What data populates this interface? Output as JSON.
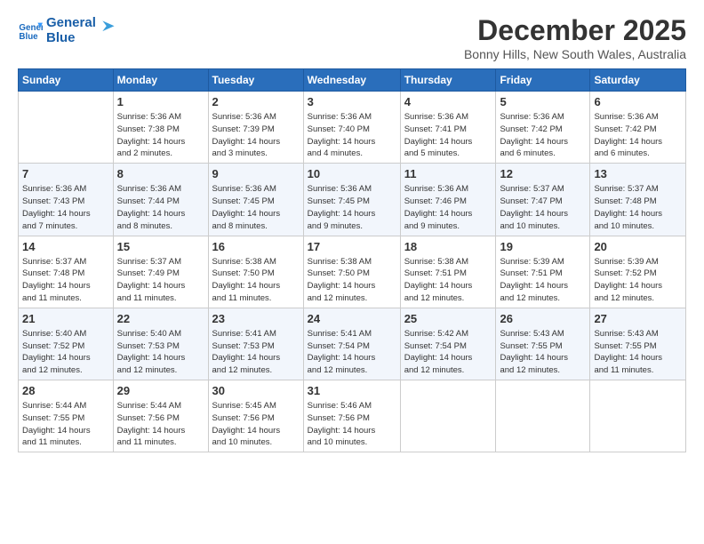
{
  "logo": {
    "line1": "General",
    "line2": "Blue"
  },
  "title": "December 2025",
  "location": "Bonny Hills, New South Wales, Australia",
  "days_of_week": [
    "Sunday",
    "Monday",
    "Tuesday",
    "Wednesday",
    "Thursday",
    "Friday",
    "Saturday"
  ],
  "weeks": [
    [
      {
        "day": "",
        "info": ""
      },
      {
        "day": "1",
        "info": "Sunrise: 5:36 AM\nSunset: 7:38 PM\nDaylight: 14 hours\nand 2 minutes."
      },
      {
        "day": "2",
        "info": "Sunrise: 5:36 AM\nSunset: 7:39 PM\nDaylight: 14 hours\nand 3 minutes."
      },
      {
        "day": "3",
        "info": "Sunrise: 5:36 AM\nSunset: 7:40 PM\nDaylight: 14 hours\nand 4 minutes."
      },
      {
        "day": "4",
        "info": "Sunrise: 5:36 AM\nSunset: 7:41 PM\nDaylight: 14 hours\nand 5 minutes."
      },
      {
        "day": "5",
        "info": "Sunrise: 5:36 AM\nSunset: 7:42 PM\nDaylight: 14 hours\nand 6 minutes."
      },
      {
        "day": "6",
        "info": "Sunrise: 5:36 AM\nSunset: 7:42 PM\nDaylight: 14 hours\nand 6 minutes."
      }
    ],
    [
      {
        "day": "7",
        "info": "Sunrise: 5:36 AM\nSunset: 7:43 PM\nDaylight: 14 hours\nand 7 minutes."
      },
      {
        "day": "8",
        "info": "Sunrise: 5:36 AM\nSunset: 7:44 PM\nDaylight: 14 hours\nand 8 minutes."
      },
      {
        "day": "9",
        "info": "Sunrise: 5:36 AM\nSunset: 7:45 PM\nDaylight: 14 hours\nand 8 minutes."
      },
      {
        "day": "10",
        "info": "Sunrise: 5:36 AM\nSunset: 7:45 PM\nDaylight: 14 hours\nand 9 minutes."
      },
      {
        "day": "11",
        "info": "Sunrise: 5:36 AM\nSunset: 7:46 PM\nDaylight: 14 hours\nand 9 minutes."
      },
      {
        "day": "12",
        "info": "Sunrise: 5:37 AM\nSunset: 7:47 PM\nDaylight: 14 hours\nand 10 minutes."
      },
      {
        "day": "13",
        "info": "Sunrise: 5:37 AM\nSunset: 7:48 PM\nDaylight: 14 hours\nand 10 minutes."
      }
    ],
    [
      {
        "day": "14",
        "info": "Sunrise: 5:37 AM\nSunset: 7:48 PM\nDaylight: 14 hours\nand 11 minutes."
      },
      {
        "day": "15",
        "info": "Sunrise: 5:37 AM\nSunset: 7:49 PM\nDaylight: 14 hours\nand 11 minutes."
      },
      {
        "day": "16",
        "info": "Sunrise: 5:38 AM\nSunset: 7:50 PM\nDaylight: 14 hours\nand 11 minutes."
      },
      {
        "day": "17",
        "info": "Sunrise: 5:38 AM\nSunset: 7:50 PM\nDaylight: 14 hours\nand 12 minutes."
      },
      {
        "day": "18",
        "info": "Sunrise: 5:38 AM\nSunset: 7:51 PM\nDaylight: 14 hours\nand 12 minutes."
      },
      {
        "day": "19",
        "info": "Sunrise: 5:39 AM\nSunset: 7:51 PM\nDaylight: 14 hours\nand 12 minutes."
      },
      {
        "day": "20",
        "info": "Sunrise: 5:39 AM\nSunset: 7:52 PM\nDaylight: 14 hours\nand 12 minutes."
      }
    ],
    [
      {
        "day": "21",
        "info": "Sunrise: 5:40 AM\nSunset: 7:52 PM\nDaylight: 14 hours\nand 12 minutes."
      },
      {
        "day": "22",
        "info": "Sunrise: 5:40 AM\nSunset: 7:53 PM\nDaylight: 14 hours\nand 12 minutes."
      },
      {
        "day": "23",
        "info": "Sunrise: 5:41 AM\nSunset: 7:53 PM\nDaylight: 14 hours\nand 12 minutes."
      },
      {
        "day": "24",
        "info": "Sunrise: 5:41 AM\nSunset: 7:54 PM\nDaylight: 14 hours\nand 12 minutes."
      },
      {
        "day": "25",
        "info": "Sunrise: 5:42 AM\nSunset: 7:54 PM\nDaylight: 14 hours\nand 12 minutes."
      },
      {
        "day": "26",
        "info": "Sunrise: 5:43 AM\nSunset: 7:55 PM\nDaylight: 14 hours\nand 12 minutes."
      },
      {
        "day": "27",
        "info": "Sunrise: 5:43 AM\nSunset: 7:55 PM\nDaylight: 14 hours\nand 11 minutes."
      }
    ],
    [
      {
        "day": "28",
        "info": "Sunrise: 5:44 AM\nSunset: 7:55 PM\nDaylight: 14 hours\nand 11 minutes."
      },
      {
        "day": "29",
        "info": "Sunrise: 5:44 AM\nSunset: 7:56 PM\nDaylight: 14 hours\nand 11 minutes."
      },
      {
        "day": "30",
        "info": "Sunrise: 5:45 AM\nSunset: 7:56 PM\nDaylight: 14 hours\nand 10 minutes."
      },
      {
        "day": "31",
        "info": "Sunrise: 5:46 AM\nSunset: 7:56 PM\nDaylight: 14 hours\nand 10 minutes."
      },
      {
        "day": "",
        "info": ""
      },
      {
        "day": "",
        "info": ""
      },
      {
        "day": "",
        "info": ""
      }
    ]
  ]
}
